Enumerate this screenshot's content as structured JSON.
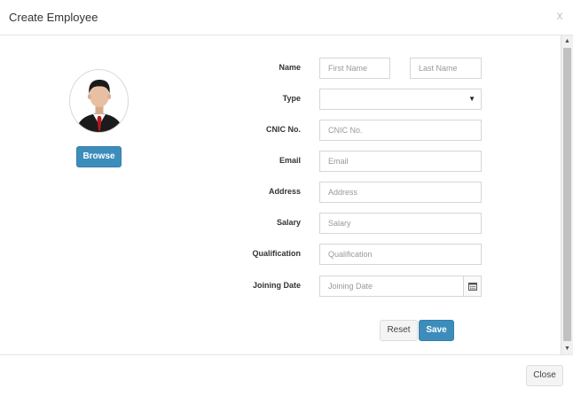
{
  "modal": {
    "title": "Create Employee",
    "close_x": "x"
  },
  "profile": {
    "browse_label": "Browse",
    "avatar_icon": "user-avatar-icon"
  },
  "form": {
    "name_label": "Name",
    "first_name_placeholder": "First Name",
    "last_name_placeholder": "Last Name",
    "type_label": "Type",
    "type_selected": "",
    "cnic_label": "CNIC No.",
    "cnic_placeholder": "CNIC No.",
    "email_label": "Email",
    "email_placeholder": "Email",
    "address_label": "Address",
    "address_placeholder": "Address",
    "salary_label": "Salary",
    "salary_placeholder": "Salary",
    "qualification_label": "Qualification",
    "qualification_placeholder": "Qualification",
    "joining_date_label": "Joining Date",
    "joining_date_placeholder": "Joining Date",
    "reset_label": "Reset",
    "save_label": "Save"
  },
  "footer": {
    "close_label": "Close"
  },
  "colors": {
    "primary": "#3c8dbc",
    "border": "#d2d6de"
  }
}
